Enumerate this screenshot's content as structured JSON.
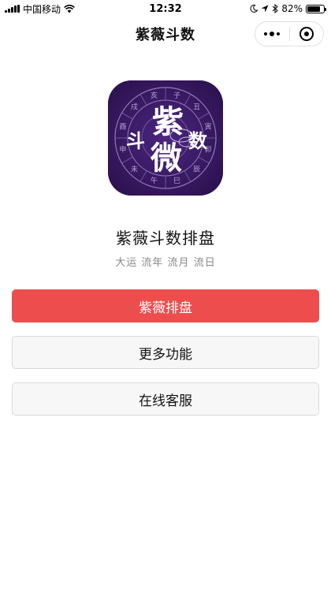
{
  "status_bar": {
    "carrier": "中国移动",
    "time": "12:32",
    "battery": "82%",
    "battery_level": 0.82,
    "icons": [
      "signal-icon",
      "wifi-icon",
      "moon-icon",
      "location-icon",
      "bluetooth-icon",
      "battery-icon"
    ]
  },
  "nav": {
    "title": "紫薇斗数",
    "capsule_icons": [
      "more-dots-icon",
      "close-target-icon"
    ]
  },
  "app": {
    "logo_glyphs": [
      "紫",
      "斗",
      "微",
      "数"
    ],
    "logo_ring_glyphs": [
      "子",
      "丑",
      "寅",
      "卯",
      "辰",
      "巳",
      "午",
      "未",
      "申",
      "酉",
      "戌",
      "亥"
    ],
    "name": "紫薇斗数排盘",
    "subtitle": "大运 流年 流月 流日"
  },
  "buttons": {
    "primary": "紫薇排盘",
    "more": "更多功能",
    "service": "在线客服"
  },
  "colors": {
    "primary_button": "#ee4d4d",
    "logo_background": "#3a1a64",
    "secondary_button": "#f7f7f7"
  }
}
